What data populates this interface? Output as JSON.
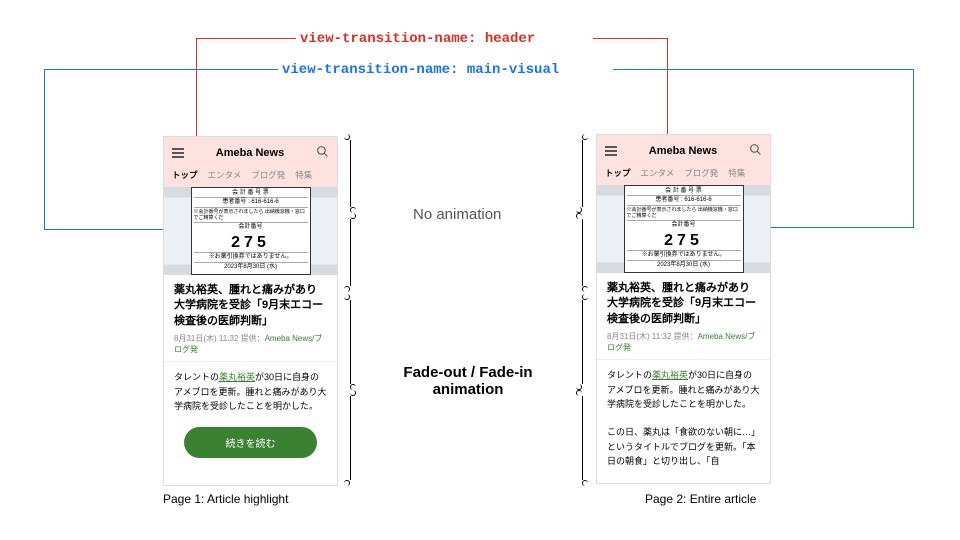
{
  "labels": {
    "header": "view-transition-name: header",
    "mainVisual": "view-transition-name: main-visual"
  },
  "phone": {
    "logo": "Ameba News",
    "tabs": [
      "トップ",
      "エンタメ",
      "ブログ発",
      "特集"
    ],
    "ticket": {
      "t1": "会 計 番 号 票",
      "t2": "患者番号 : 616-616-6",
      "t3": "※会計番号が表示されましたら 出納機窓機・窓口でご精算くだ",
      "numLabel": "会計番号",
      "num": "275",
      "t4": "※お薬引換券ではありません。",
      "t5": "2023年8月30日 (水)"
    },
    "articleTitle": "薬丸裕英、腫れと痛みがあり大学病院を受診「9月末エコー検査後の医師判断」",
    "metaTime": "8月31日(木) 11:32",
    "metaLabel": "提供：",
    "metaSource": "Ameba News/ブログ発",
    "bodyPre": "タレントの",
    "bodyLink": "薬丸裕英",
    "bodyPost": "が30日に自身のアメブロを更新。腫れと痛みがあり大学病院を受診したことを明かした。",
    "readMore": "続きを読む",
    "continued": "この日、薬丸は「食欲のない朝に…」というタイトルでブログを更新。「本日の朝食」と切り出し、「自"
  },
  "captions": {
    "page1": "Page 1: Article highlight",
    "page2": "Page 2: Entire article"
  },
  "annotations": {
    "noAnim": "No animation",
    "fadeAnim": "Fade-out / Fade-in animation"
  }
}
